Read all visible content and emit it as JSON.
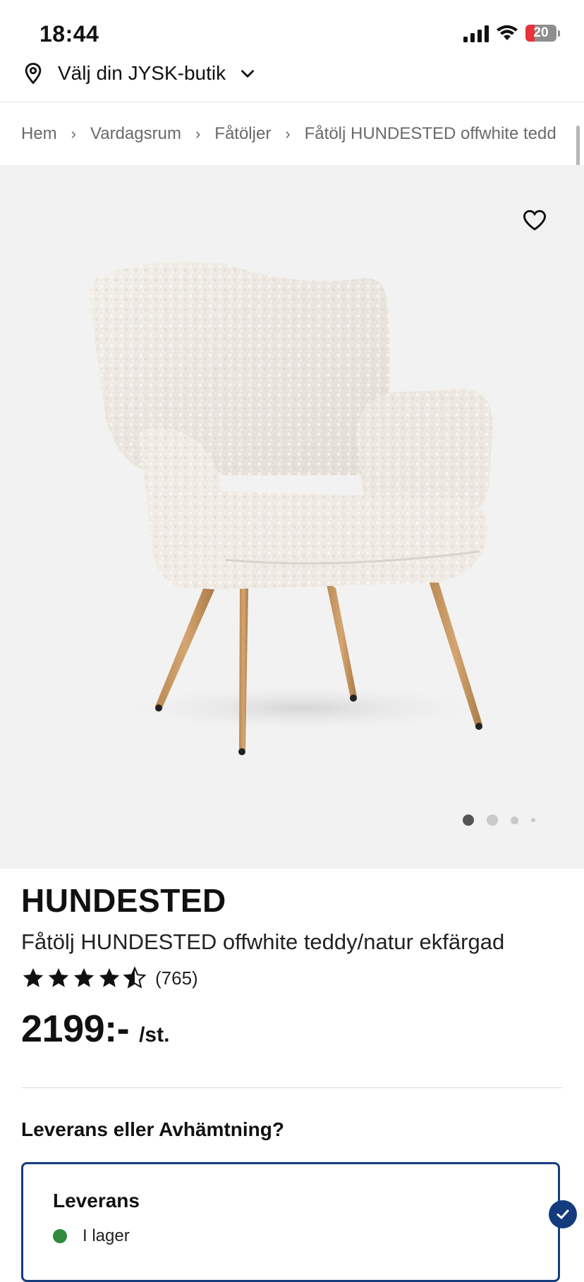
{
  "status_bar": {
    "time": "18:44",
    "battery": "20"
  },
  "header": {
    "store_label": "Välj din JYSK-butik"
  },
  "breadcrumb": {
    "items": [
      "Hem",
      "Vardagsrum",
      "Fåtöljer",
      "Fåtölj HUNDESTED offwhite tedd"
    ],
    "separator": "›"
  },
  "product": {
    "name": "HUNDESTED",
    "description": "Fåtölj HUNDESTED offwhite teddy/natur ekfärgad",
    "rating": 4.5,
    "review_count": "(765)",
    "price": "2199:-",
    "price_unit": "/st.",
    "image_count": 4,
    "active_image": 1
  },
  "delivery": {
    "heading": "Leverans eller Avhämtning?",
    "card_title": "Leverans",
    "stock_status": "I lager"
  },
  "colors": {
    "brand_blue": "#143c7d",
    "in_stock_green": "#2e8b3a",
    "image_bg": "#f3f2f2"
  }
}
